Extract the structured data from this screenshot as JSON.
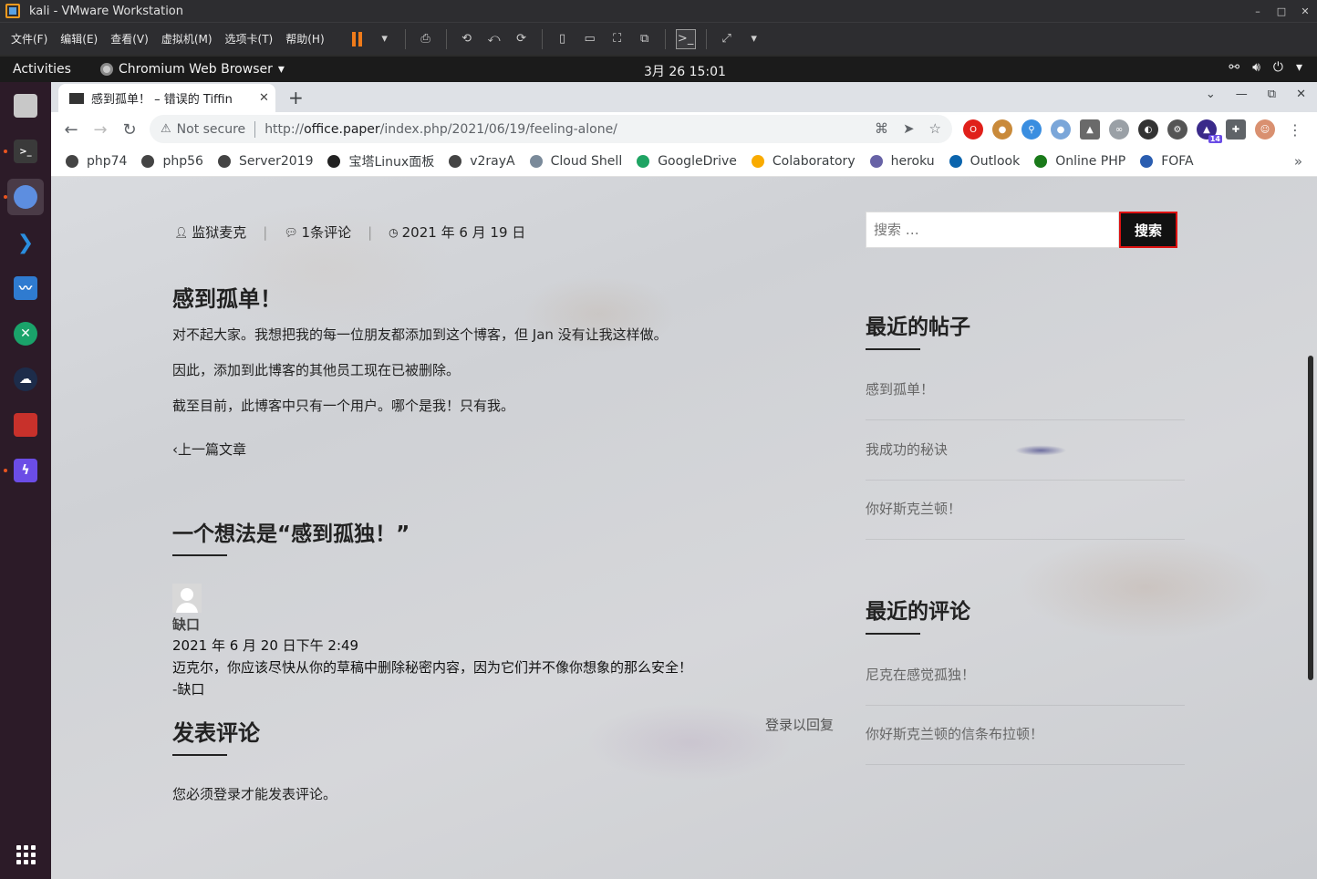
{
  "vmware": {
    "title": "kali - VMware Workstation",
    "menu": [
      "文件(F)",
      "编辑(E)",
      "查看(V)",
      "虚拟机(M)",
      "选项卡(T)",
      "帮助(H)"
    ],
    "window_controls": [
      "–",
      "□",
      "✕"
    ]
  },
  "gnome": {
    "activities": "Activities",
    "app_menu": "Chromium Web Browser",
    "clock": "3月 26  15:01"
  },
  "dock": {
    "items": [
      "files-icon",
      "terminal-icon",
      "chromium-icon",
      "vscode-icon",
      "system-monitor-icon",
      "app-x-icon",
      "app-cloud-icon",
      "app-red-icon",
      "app-bolt-icon"
    ]
  },
  "chrome": {
    "tab_title": "感到孤单！ – 错误的 Tiffin",
    "omnibox": {
      "security": "Not secure",
      "url_prefix": "http://",
      "url_host": "office.paper",
      "url_path": "/index.php/2021/06/19/feeling-alone/"
    },
    "ext_badge": "14",
    "bookmarks": [
      {
        "label": "php74",
        "color": "#444444",
        "icon": "globe-icon"
      },
      {
        "label": "php56",
        "color": "#444444",
        "icon": "globe-icon"
      },
      {
        "label": "Server2019",
        "color": "#444444",
        "icon": "globe-icon"
      },
      {
        "label": "宝塔Linux面板",
        "color": "#222222",
        "icon": "bt-icon"
      },
      {
        "label": "v2rayA",
        "color": "#444444",
        "icon": "globe-icon"
      },
      {
        "label": "Cloud Shell",
        "color": "#7a8a9a",
        "icon": "cloud-shell-icon"
      },
      {
        "label": "GoogleDrive",
        "color": "#1fa463",
        "icon": "drive-icon"
      },
      {
        "label": "Colaboratory",
        "color": "#f9ab00",
        "icon": "colab-icon"
      },
      {
        "label": "heroku",
        "color": "#6762a6",
        "icon": "heroku-icon"
      },
      {
        "label": "Outlook",
        "color": "#0a64ad",
        "icon": "outlook-icon"
      },
      {
        "label": "Online PHP",
        "color": "#1a7a1a",
        "icon": "php-icon"
      },
      {
        "label": "FOFA",
        "color": "#2a5db0",
        "icon": "fofa-icon"
      }
    ]
  },
  "post": {
    "author": "监狱麦克",
    "comments_count": "1条评论",
    "date": "2021 年 6 月 19 日",
    "title": "感到孤单！",
    "paragraphs": [
      "对不起大家。我想把我的每一位朋友都添加到这个博客，但 Jan 没有让我这样做。",
      "因此，添加到此博客的其他员工现在已被删除。",
      "截至目前，此博客中只有一个用户。哪个是我！只有我。"
    ],
    "prev_link": "上一篇文章"
  },
  "comments": {
    "heading": "一个想法是“感到孤独！”",
    "author": "缺口",
    "date": "2021 年 6 月 20 日下午 2:49",
    "text": "迈克尔，你应该尽快从你的草稿中删除秘密内容，因为它们并不像你想象的那么安全！",
    "signature": "-缺口",
    "reply_login": "登录以回复",
    "leave_heading": "发表评论",
    "must_login": "您必须登录才能发表评论。"
  },
  "sidebar": {
    "search_placeholder": "搜索 …",
    "search_button": "搜索",
    "recent_posts_heading": "最近的帖子",
    "recent_posts": [
      "感到孤单！",
      "我成功的秘诀",
      "你好斯克兰顿！"
    ],
    "recent_comments_heading": "最近的评论",
    "recent_comments": [
      "尼克在感觉孤独！",
      "你好斯克兰顿的信条布拉顿！"
    ]
  }
}
